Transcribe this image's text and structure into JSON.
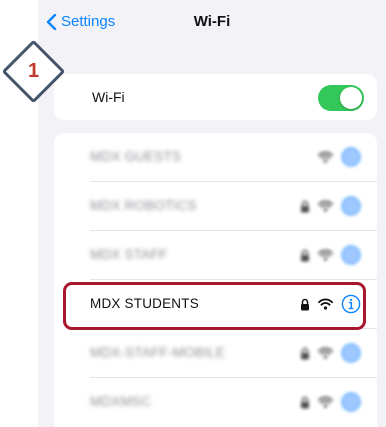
{
  "nav": {
    "back_label": "Settings",
    "title": "Wi-Fi"
  },
  "wifi_toggle": {
    "label": "Wi-Fi",
    "on": true
  },
  "networks": [
    {
      "name": "MDX GUESTS",
      "locked": false,
      "blurred": true
    },
    {
      "name": "MDX ROBOTICS",
      "locked": true,
      "blurred": true
    },
    {
      "name": "MDX STAFF",
      "locked": true,
      "blurred": true
    },
    {
      "name": "MDX STUDENTS",
      "locked": true,
      "blurred": false
    },
    {
      "name": "MDX-STAFF-MOBILE",
      "locked": true,
      "blurred": true
    },
    {
      "name": "MDXMSC",
      "locked": true,
      "blurred": true
    }
  ],
  "annotation": {
    "step_number": "1"
  },
  "colors": {
    "accent": "#0a84ff",
    "toggle_on": "#34c759",
    "highlight": "#a8172d",
    "badge_border": "#44546a",
    "badge_text": "#c0392b"
  },
  "icons": [
    "chevron-left-icon",
    "lock-icon",
    "wifi-icon",
    "info-icon"
  ]
}
